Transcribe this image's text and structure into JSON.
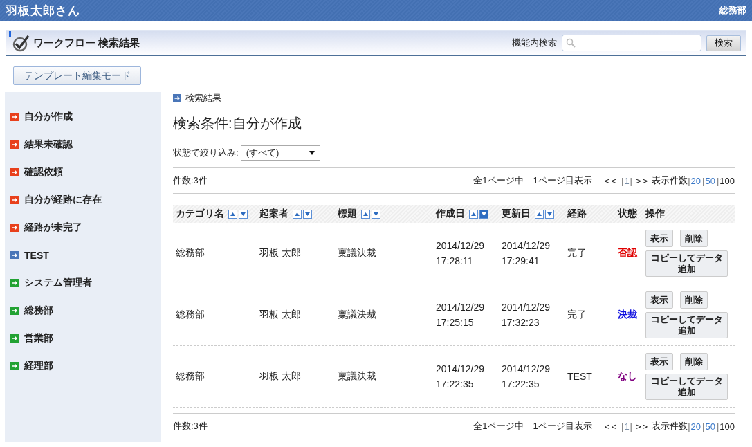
{
  "top_bar": {
    "user": "羽板太郎さん",
    "department": "総務部"
  },
  "header": {
    "title": "ワークフロー 検索結果",
    "search_label": "機能内検索",
    "search_button": "検索"
  },
  "template_button": "テンプレート編集モード",
  "sidebar": {
    "items": [
      {
        "label": "自分が作成",
        "color": "#e8401c"
      },
      {
        "label": "結果未確認",
        "color": "#e8401c"
      },
      {
        "label": "確認依頼",
        "color": "#e8401c"
      },
      {
        "label": "自分が経路に存在",
        "color": "#e8401c"
      },
      {
        "label": "経路が未完了",
        "color": "#e8401c"
      },
      {
        "label": "TEST",
        "color": "#4a76b8"
      },
      {
        "label": "システム管理者",
        "color": "#22a233"
      },
      {
        "label": "総務部",
        "color": "#22a233"
      },
      {
        "label": "営業部",
        "color": "#22a233"
      },
      {
        "label": "経理部",
        "color": "#22a233"
      }
    ]
  },
  "breadcrumb": "検索結果",
  "heading": "検索条件:自分が作成",
  "filter": {
    "label": "状態で絞り込み:",
    "value": "(すべて)"
  },
  "pager_top": {
    "count": "件数:3件",
    "items": [
      {
        "kind": "text",
        "label": "全1ページ中"
      },
      {
        "kind": "text",
        "label": "1ページ目表示"
      },
      {
        "kind": "nav",
        "label": "<<"
      },
      {
        "kind": "sep",
        "label": "|"
      },
      {
        "kind": "page",
        "label": "1"
      },
      {
        "kind": "sep",
        "label": "|"
      },
      {
        "kind": "nav",
        "label": ">>"
      },
      {
        "kind": "text",
        "label": "表示件数"
      },
      {
        "kind": "sep",
        "label": "|"
      },
      {
        "kind": "size",
        "label": "20",
        "selected": false
      },
      {
        "kind": "sep",
        "label": "|"
      },
      {
        "kind": "size",
        "label": "50",
        "selected": false
      },
      {
        "kind": "sep",
        "label": "|"
      },
      {
        "kind": "size",
        "label": "100",
        "selected": true
      }
    ]
  },
  "table": {
    "columns": [
      {
        "label": "カテゴリ名",
        "sort": {
          "asc_selected": false,
          "desc_selected": false
        }
      },
      {
        "label": "起案者",
        "sort": {
          "asc_selected": false,
          "desc_selected": false
        }
      },
      {
        "label": "標題",
        "sort": {
          "asc_selected": false,
          "desc_selected": false
        }
      },
      {
        "label": "作成日",
        "sort": {
          "asc_selected": false,
          "desc_selected": true
        }
      },
      {
        "label": "更新日",
        "sort": {
          "asc_selected": false,
          "desc_selected": false
        }
      },
      {
        "label": "経路"
      },
      {
        "label": "状態"
      },
      {
        "label": "操作"
      }
    ],
    "rows": [
      {
        "category": "総務部",
        "drafter": "羽板 太郎",
        "title": "稟議決裁",
        "created": "2014/12/29 17:28:11",
        "updated": "2014/12/29 17:29:41",
        "route": "完了",
        "status": {
          "label": "否認",
          "color": "#e00000"
        },
        "actions": [
          "表示",
          "削除",
          "コピーしてデータ追加"
        ]
      },
      {
        "category": "総務部",
        "drafter": "羽板 太郎",
        "title": "稟議決裁",
        "created": "2014/12/29 17:25:15",
        "updated": "2014/12/29 17:32:23",
        "route": "完了",
        "status": {
          "label": "決裁",
          "color": "#1010e0"
        },
        "actions": [
          "表示",
          "削除",
          "コピーしてデータ追加"
        ]
      },
      {
        "category": "総務部",
        "drafter": "羽板 太郎",
        "title": "稟議決裁",
        "created": "2014/12/29 17:22:35",
        "updated": "2014/12/29 17:22:35",
        "route": "TEST",
        "status": {
          "label": "なし",
          "color": "#800080"
        },
        "actions": [
          "表示",
          "削除",
          "コピーしてデータ追加"
        ]
      }
    ]
  },
  "pager_bottom": {
    "count": "件数:3件",
    "items": [
      {
        "kind": "text",
        "label": "全1ページ中"
      },
      {
        "kind": "text",
        "label": "1ページ目表示"
      },
      {
        "kind": "nav",
        "label": "<<"
      },
      {
        "kind": "sep",
        "label": "|"
      },
      {
        "kind": "page",
        "label": "1"
      },
      {
        "kind": "sep",
        "label": "|"
      },
      {
        "kind": "nav",
        "label": ">>"
      },
      {
        "kind": "text",
        "label": "表示件数"
      },
      {
        "kind": "sep",
        "label": "|"
      },
      {
        "kind": "size",
        "label": "20",
        "selected": false
      },
      {
        "kind": "sep",
        "label": "|"
      },
      {
        "kind": "size",
        "label": "50",
        "selected": false
      },
      {
        "kind": "sep",
        "label": "|"
      },
      {
        "kind": "size",
        "label": "100",
        "selected": true
      }
    ]
  }
}
